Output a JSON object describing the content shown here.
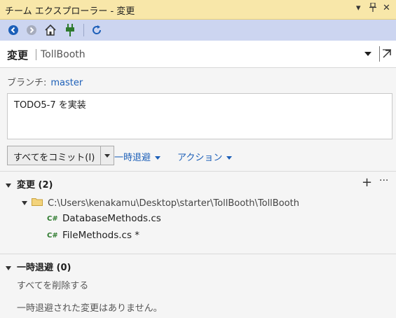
{
  "window": {
    "title": "チーム エクスプローラー - 変更",
    "menu_icon": "dropdown-arrow",
    "pin_icon": "pin",
    "close_icon": "close"
  },
  "toolbar": {
    "icons": [
      "back-arrow",
      "forward-arrow",
      "home",
      "plug",
      "refresh"
    ]
  },
  "header": {
    "title": "変更",
    "repo": "TollBooth"
  },
  "branch": {
    "label": "ブランチ:",
    "name": "master"
  },
  "commit": {
    "message": "TODO5-7 を実装",
    "button_label": "すべてをコミット(I)"
  },
  "actions": {
    "stash_label": "一時退避",
    "action_label": "アクション"
  },
  "changes": {
    "header": "変更 (2)",
    "folder_path": "C:\\Users\\kenakamu\\Desktop\\starter\\TollBooth\\TollBooth",
    "files": [
      {
        "icon": "C#",
        "name": "DatabaseMethods.cs"
      },
      {
        "icon": "C#",
        "name": "FileMethods.cs *"
      }
    ]
  },
  "stashes": {
    "header": "一時退避 (0)",
    "delete_all": "すべてを削除する",
    "empty_message": "一時退避された変更はありません。"
  },
  "colors": {
    "titlebar": "#f8e7a9",
    "toolbar": "#ccd5f0",
    "link": "#1c5fb8",
    "cs_icon": "#2d7a2d"
  }
}
